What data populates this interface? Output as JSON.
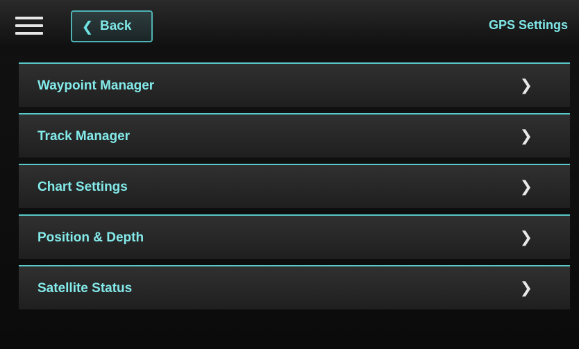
{
  "header": {
    "menu_icon": "hamburger-icon",
    "back_label": "Back",
    "back_icon": "chevron-left-icon",
    "title": "GPS Settings"
  },
  "menu": {
    "item_icon": "chevron-right-icon",
    "items": [
      {
        "label": "Waypoint Manager"
      },
      {
        "label": "Track Manager"
      },
      {
        "label": "Chart Settings"
      },
      {
        "label": "Position & Depth"
      },
      {
        "label": "Satellite Status"
      }
    ]
  },
  "colors": {
    "accent": "#59c9c9",
    "text_accent": "#84eaea",
    "background": "#0b0b0b"
  }
}
